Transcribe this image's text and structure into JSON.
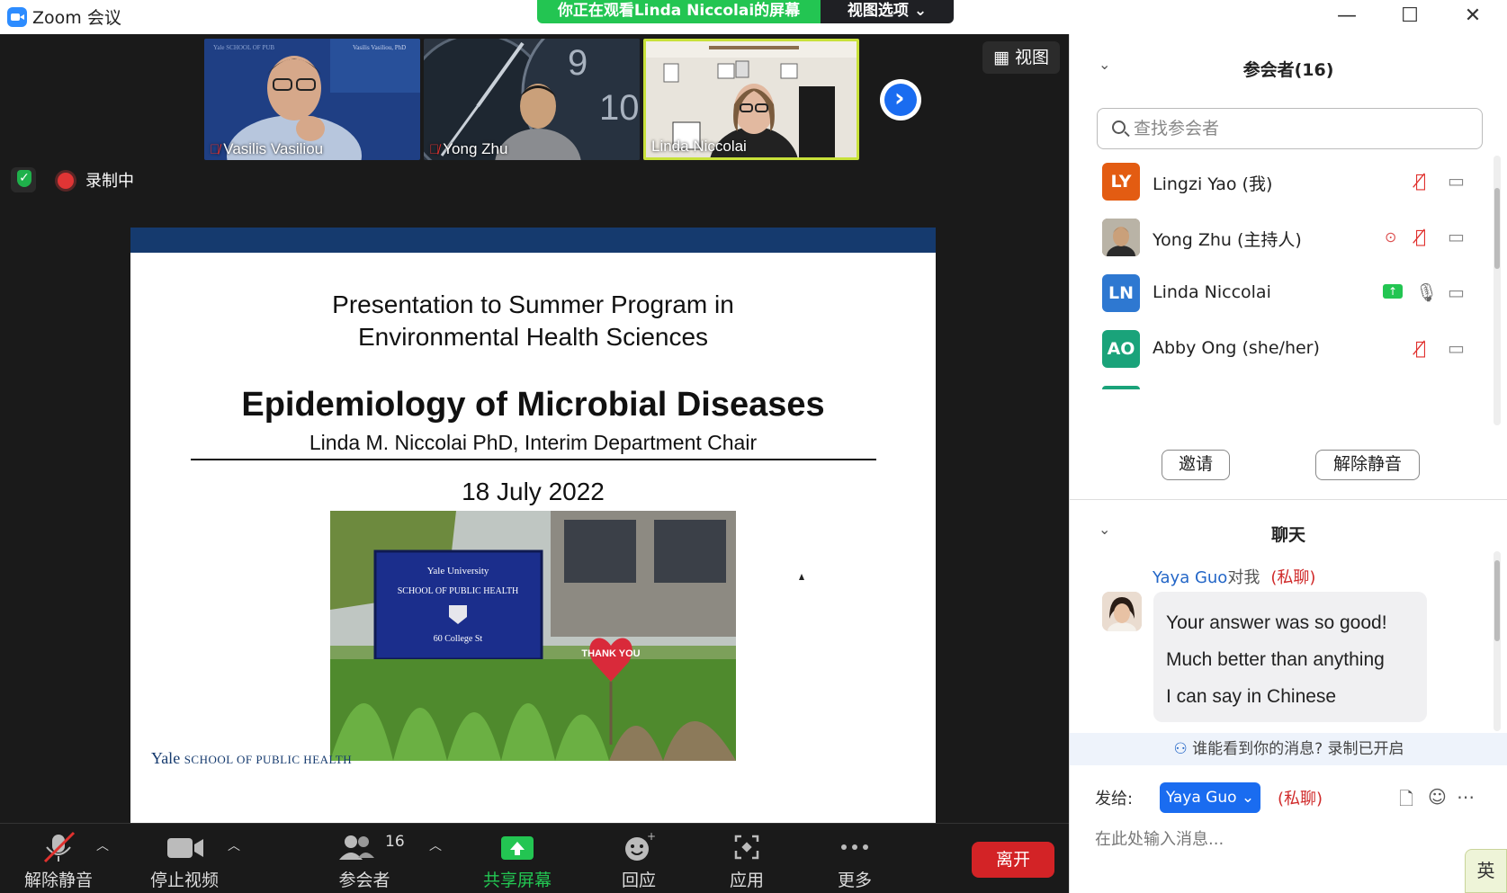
{
  "window": {
    "title": "Zoom 会议",
    "viewing_banner": "你正在观看Linda Niccolai的屏幕",
    "view_options": "视图选项 ⌄",
    "minimize": "—",
    "maximize": "☐",
    "close": "✕"
  },
  "video_strip": {
    "thumbs": [
      {
        "name": "Vasilis Vasiliou",
        "muted": true
      },
      {
        "name": "Yong Zhu",
        "muted": true
      },
      {
        "name": "Linda Niccolai",
        "muted": false
      }
    ],
    "view_button": "视图",
    "next_arrow": "›"
  },
  "status": {
    "recording_label": "录制中"
  },
  "slide": {
    "subtitle_line1": "Presentation to Summer Program in",
    "subtitle_line2": "Environmental Health Sciences",
    "title": "Epidemiology of Microbial Diseases",
    "author": "Linda M. Niccolai PhD, Interim Department Chair",
    "date": "18 July 2022",
    "photo_sign_line1": "Yale University",
    "photo_sign_line2": "SCHOOL OF PUBLIC HEALTH",
    "photo_sign_line3": "60 College St",
    "photo_heart": "THANK YOU",
    "footer_big": "Yale",
    "footer_small": "SCHOOL OF PUBLIC HEALTH"
  },
  "toolbar": {
    "unmute": "解除静音",
    "stop_video": "停止视频",
    "participants": "参会者",
    "participants_count": "16",
    "share_screen": "共享屏幕",
    "reactions": "回应",
    "apps": "应用",
    "more": "更多",
    "leave": "离开"
  },
  "participants_panel": {
    "title": "参会者(16)",
    "search_placeholder": "查找参会者",
    "invite": "邀请",
    "unmute_all": "解除静音",
    "list": [
      {
        "initials": "LY",
        "name": "Lingzi Yao (我)",
        "color": "#e35c12"
      },
      {
        "initials": "",
        "name": "Yong Zhu (主持人)",
        "color": "#8a6e5a"
      },
      {
        "initials": "LN",
        "name": "Linda Niccolai",
        "color": "#2e78d1"
      },
      {
        "initials": "AO",
        "name": "Abby Ong (she/her)",
        "color": "#1aa37a"
      }
    ]
  },
  "chat_panel": {
    "title": "聊天",
    "sender": "Yaya Guo",
    "to_me": "对我",
    "private_tag": "(私聊)",
    "message": [
      "Your answer was so good!",
      "Much better than anything",
      "I can say in Chinese"
    ],
    "notice": "谁能看到你的消息? 录制已开启",
    "send_to_label": "发给:",
    "send_to_value": "Yaya Guo ⌄",
    "send_private": "(私聊)",
    "input_placeholder": "在此处输入消息..."
  },
  "ime": {
    "label": "英"
  },
  "colors": {
    "accent_blue": "#1a6cf0",
    "share_green": "#23c552",
    "leave_red": "#d32326",
    "mute_red": "#e0312e"
  }
}
